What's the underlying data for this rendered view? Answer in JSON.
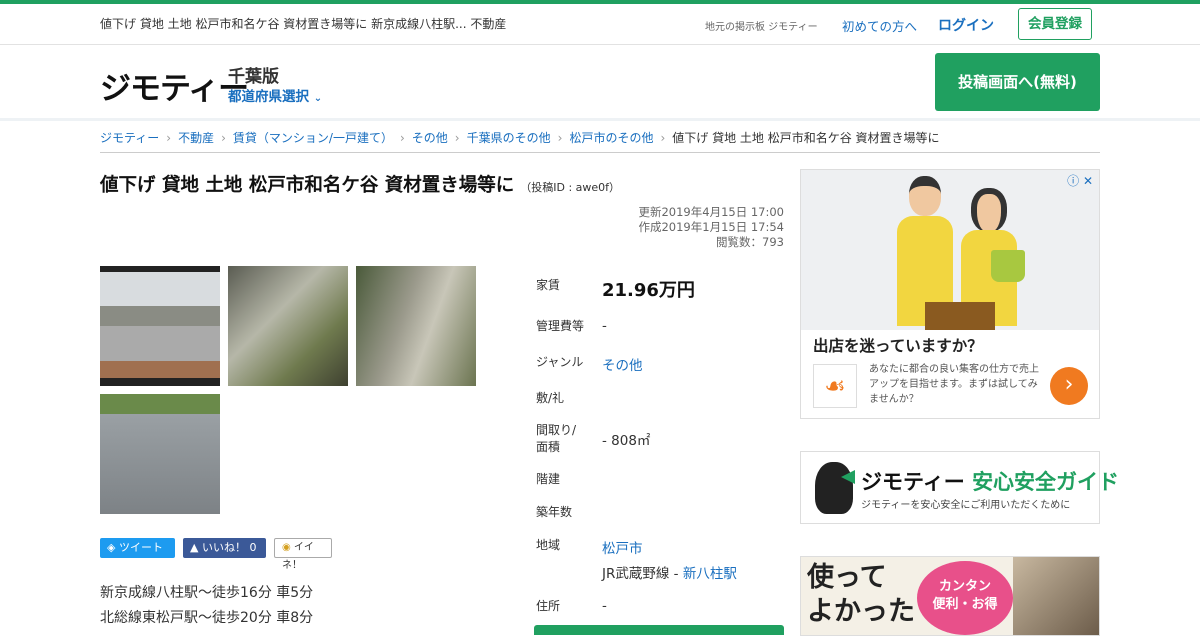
{
  "topbar": {
    "page_title": "値下げ 貸地 土地 松戸市和名ケ谷 資材置き場等に 新京成線八柱駅... 不動産",
    "board_label": "地元の掲示板 ジモティー",
    "first_time": "初めての方へ",
    "login": "ログイン",
    "register": "会員登録"
  },
  "header": {
    "logo": "ジモティー",
    "edition": "千葉版",
    "prefecture_select": "都道府県選択",
    "post_button": "投稿画面へ(無料)"
  },
  "breadcrumb": [
    "ジモティー",
    "不動産",
    "賃貸（マンション/一戸建て）",
    "その他",
    "千葉県のその他",
    "松戸市のその他"
  ],
  "breadcrumb_current": "値下げ 貸地 土地 松戸市和名ケ谷 資材置き場等に",
  "listing": {
    "title": "値下げ 貸地 土地 松戸市和名ケ谷 資材置き場等に",
    "post_id": "（投稿ID : awe0f）",
    "updated": "更新2019年4月15日 17:00",
    "created": "作成2019年1月15日 17:54",
    "views": "閲覧数：793"
  },
  "social": {
    "tweet": "ツイート",
    "like": "いいね！ 0",
    "iine": "イイネ！"
  },
  "access": [
    "新京成線八柱駅～徒歩16分 車5分",
    "北総線東松戸駅～徒歩20分 車8分"
  ],
  "spec": {
    "rent_label": "家賃",
    "rent_value": "21.96万円",
    "mgmt_label": "管理費等",
    "mgmt_value": "-",
    "genre_label": "ジャンル",
    "genre_value": "その他",
    "deposit_label": "敷/礼",
    "layout_label_1": "間取り/",
    "layout_label_2": "面積",
    "layout_value": "- 808㎡",
    "floors_label": "階建",
    "age_label": "築年数",
    "area_label": "地域",
    "area_city": "松戸市",
    "area_line": "JR武蔵野線 - ",
    "area_station": "新八柱駅",
    "address_label": "住所",
    "address_value": "-"
  },
  "ads": {
    "ad1_title": "出店を迷っていますか？",
    "ad1_text": "あなたに都合の良い集客の仕方で売上アップを目指せます。まずは試してみませんか？",
    "guide_title_a": "ジモティー",
    "guide_title_b": "安心安全ガイド",
    "guide_sub": "ジモティーを安心安全にご利用いただくために",
    "ad3_big": "使って\nよかった",
    "ad3_bubble": "カンタン\n便利・お得"
  }
}
